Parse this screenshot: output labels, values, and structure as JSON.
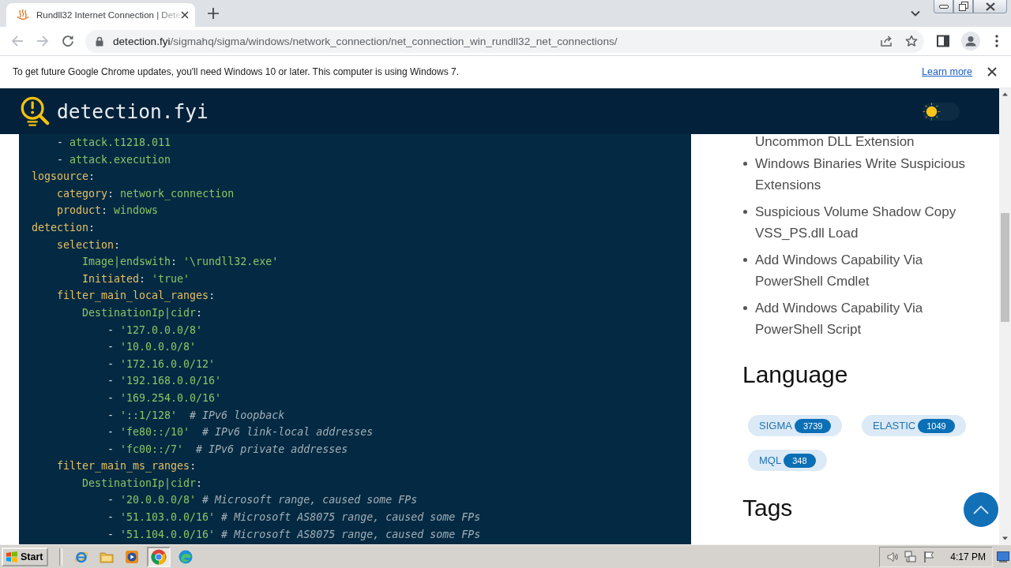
{
  "browser": {
    "tab": {
      "title": "Rundll32 Internet Connection | Dete",
      "selected": true
    },
    "back_button": {
      "disabled": true
    },
    "forward_button": {
      "disabled": true
    },
    "address": {
      "host": "detection.fyi",
      "path": "/sigmahq/sigma/windows/network_connection/net_connection_win_rundll32_net_connections/"
    }
  },
  "infobar": {
    "message": "To get future Google Chrome updates, you'll need Windows 10 or later. This computer is using Windows 7.",
    "link": "Learn more"
  },
  "site_header": {
    "title": "detection.fyi",
    "theme_switch": {
      "on": false
    }
  },
  "code": {
    "continued_items": [
      {
        "tokens": [
          {
            "kind": "punct",
            "text": "- "
          },
          {
            "kind": "value",
            "text": "attack.t1218.011"
          }
        ]
      },
      {
        "tokens": [
          {
            "kind": "punct",
            "text": "- "
          },
          {
            "kind": "value",
            "text": "attack.execution"
          }
        ]
      }
    ],
    "lines": [
      {
        "tokens": [
          {
            "kind": "key",
            "text": "logsource"
          },
          {
            "kind": "punct",
            "text": ":"
          }
        ],
        "children": [
          {
            "tokens": [
              {
                "kind": "key",
                "text": "category"
              },
              {
                "kind": "punct",
                "text": ": "
              },
              {
                "kind": "value",
                "text": "network_connection"
              }
            ]
          },
          {
            "tokens": [
              {
                "kind": "key",
                "text": "product"
              },
              {
                "kind": "punct",
                "text": ": "
              },
              {
                "kind": "value",
                "text": "windows"
              }
            ]
          }
        ]
      },
      {
        "tokens": [
          {
            "kind": "key",
            "text": "detection"
          },
          {
            "kind": "punct",
            "text": ":"
          }
        ],
        "children": [
          {
            "tokens": [
              {
                "kind": "key",
                "text": "selection"
              },
              {
                "kind": "punct",
                "text": ":"
              }
            ],
            "children": [
              {
                "tokens": [
                  {
                    "kind": "value",
                    "text": "Image|endswith"
                  },
                  {
                    "kind": "punct",
                    "text": ": "
                  },
                  {
                    "kind": "value",
                    "text": "'\\rundll32.exe'"
                  }
                ]
              },
              {
                "tokens": [
                  {
                    "kind": "key",
                    "text": "Initiated"
                  },
                  {
                    "kind": "punct",
                    "text": ": "
                  },
                  {
                    "kind": "value",
                    "text": "'true'"
                  }
                ]
              }
            ]
          },
          {
            "tokens": [
              {
                "kind": "key",
                "text": "filter_main_local_ranges"
              },
              {
                "kind": "punct",
                "text": ":"
              }
            ],
            "children": [
              {
                "tokens": [
                  {
                    "kind": "value",
                    "text": "DestinationIp|cidr"
                  },
                  {
                    "kind": "punct",
                    "text": ":"
                  }
                ],
                "children": [
                  {
                    "tokens": [
                      {
                        "kind": "punct",
                        "text": "- "
                      },
                      {
                        "kind": "value",
                        "text": "'127.0.0.0/8'"
                      }
                    ]
                  },
                  {
                    "tokens": [
                      {
                        "kind": "punct",
                        "text": "- "
                      },
                      {
                        "kind": "value",
                        "text": "'10.0.0.0/8'"
                      }
                    ]
                  },
                  {
                    "tokens": [
                      {
                        "kind": "punct",
                        "text": "- "
                      },
                      {
                        "kind": "value",
                        "text": "'172.16.0.0/12'"
                      }
                    ]
                  },
                  {
                    "tokens": [
                      {
                        "kind": "punct",
                        "text": "- "
                      },
                      {
                        "kind": "value",
                        "text": "'192.168.0.0/16'"
                      }
                    ]
                  },
                  {
                    "tokens": [
                      {
                        "kind": "punct",
                        "text": "- "
                      },
                      {
                        "kind": "value",
                        "text": "'169.254.0.0/16'"
                      }
                    ]
                  },
                  {
                    "tokens": [
                      {
                        "kind": "punct",
                        "text": "- "
                      },
                      {
                        "kind": "value",
                        "text": "'::1/128'"
                      },
                      {
                        "kind": "comment",
                        "text": "  # IPv6 loopback"
                      }
                    ]
                  },
                  {
                    "tokens": [
                      {
                        "kind": "punct",
                        "text": "- "
                      },
                      {
                        "kind": "value",
                        "text": "'fe80::/10'"
                      },
                      {
                        "kind": "comment",
                        "text": "  # IPv6 link-local addresses"
                      }
                    ]
                  },
                  {
                    "tokens": [
                      {
                        "kind": "punct",
                        "text": "- "
                      },
                      {
                        "kind": "value",
                        "text": "'fc00::/7'"
                      },
                      {
                        "kind": "comment",
                        "text": "  # IPv6 private addresses"
                      }
                    ]
                  }
                ]
              }
            ]
          },
          {
            "tokens": [
              {
                "kind": "key",
                "text": "filter_main_ms_ranges"
              },
              {
                "kind": "punct",
                "text": ":"
              }
            ],
            "children": [
              {
                "tokens": [
                  {
                    "kind": "value",
                    "text": "DestinationIp|cidr"
                  },
                  {
                    "kind": "punct",
                    "text": ":"
                  }
                ],
                "children": [
                  {
                    "tokens": [
                      {
                        "kind": "punct",
                        "text": "- "
                      },
                      {
                        "kind": "value",
                        "text": "'20.0.0.0/8'"
                      },
                      {
                        "kind": "comment",
                        "text": " # Microsoft range, caused some FPs"
                      }
                    ]
                  },
                  {
                    "tokens": [
                      {
                        "kind": "punct",
                        "text": "- "
                      },
                      {
                        "kind": "value",
                        "text": "'51.103.0.0/16'"
                      },
                      {
                        "kind": "comment",
                        "text": " # Microsoft AS8075 range, caused some FPs"
                      }
                    ]
                  },
                  {
                    "tokens": [
                      {
                        "kind": "punct",
                        "text": "- "
                      },
                      {
                        "kind": "value",
                        "text": "'51.104.0.0/16'"
                      },
                      {
                        "kind": "comment",
                        "text": " # Microsoft AS8075 range, caused some FPs"
                      }
                    ]
                  }
                ]
              }
            ]
          }
        ]
      }
    ]
  },
  "sidebar": {
    "cut_item_tail": "Uncommon DLL Extension",
    "related_rules": [
      "Windows Binaries Write Suspicious Extensions",
      "Suspicious Volume Shadow Copy VSS_PS.dll Load",
      "Add Windows Capability Via PowerShell Cmdlet",
      "Add Windows Capability Via PowerShell Script"
    ],
    "language_heading": "Language",
    "languages": [
      {
        "name": "SIGMA",
        "count": "3739"
      },
      {
        "name": "ELASTIC",
        "count": "1049"
      },
      {
        "name": "MQL",
        "count": "348"
      }
    ],
    "tags_heading": "Tags"
  },
  "taskbar": {
    "start": "Start",
    "clock": "4:17 PM"
  }
}
